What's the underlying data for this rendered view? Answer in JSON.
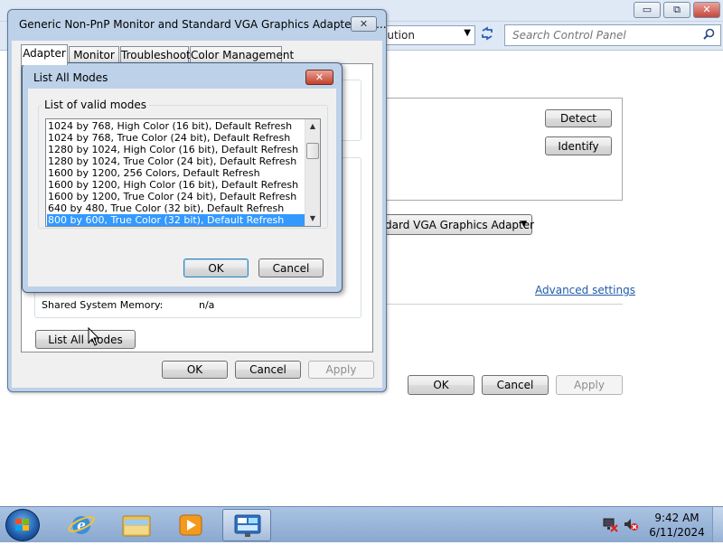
{
  "background_window": {
    "address_text": "lution",
    "search": {
      "placeholder": "Search Control Panel"
    },
    "caption": {
      "minimize": "▭",
      "maximize": "⧉",
      "close": "✕"
    },
    "detect_label": "Detect",
    "identify_label": "Identify",
    "display_combo_value": "dard VGA Graphics Adapter",
    "advanced_settings_label": "Advanced settings",
    "ok_label": "OK",
    "cancel_label": "Cancel",
    "apply_label": "Apply"
  },
  "adapter_dialog": {
    "title": "Generic Non-PnP Monitor and Standard VGA Graphics Adapter Pro...",
    "close_label": "✕",
    "tabs": [
      {
        "label": "Adapter"
      },
      {
        "label": "Monitor"
      },
      {
        "label": "Troubleshoot"
      },
      {
        "label": "Color Management"
      }
    ],
    "shared_memory_label": "Shared System Memory:",
    "shared_memory_value": "n/a",
    "list_all_modes_label": "List All Modes",
    "ok_label": "OK",
    "cancel_label": "Cancel",
    "apply_label": "Apply"
  },
  "modes_dialog": {
    "title": "List All Modes",
    "close_label": "✕",
    "group_label": "List of valid modes",
    "modes": [
      "1024 by 768, High Color (16 bit), Default Refresh",
      "1024 by 768, True Color (24 bit), Default Refresh",
      "1280 by 1024, High Color (16 bit), Default Refresh",
      "1280 by 1024, True Color (24 bit), Default Refresh",
      "1600 by 1200, 256 Colors, Default Refresh",
      "1600 by 1200, High Color (16 bit), Default Refresh",
      "1600 by 1200, True Color (24 bit), Default Refresh",
      "640 by 480, True Color (32 bit), Default Refresh",
      "800 by 600, True Color (32 bit), Default Refresh"
    ],
    "selected_mode": "800 by 600, True Color (32 bit), Default Refresh",
    "ok_label": "OK",
    "cancel_label": "Cancel"
  },
  "taskbar": {
    "time": "9:42 AM",
    "date": "6/11/2024",
    "pinned": [
      {
        "icon": "internet-explorer-icon"
      },
      {
        "icon": "windows-explorer-icon"
      },
      {
        "icon": "media-player-icon"
      },
      {
        "icon": "control-panel-icon"
      }
    ]
  }
}
